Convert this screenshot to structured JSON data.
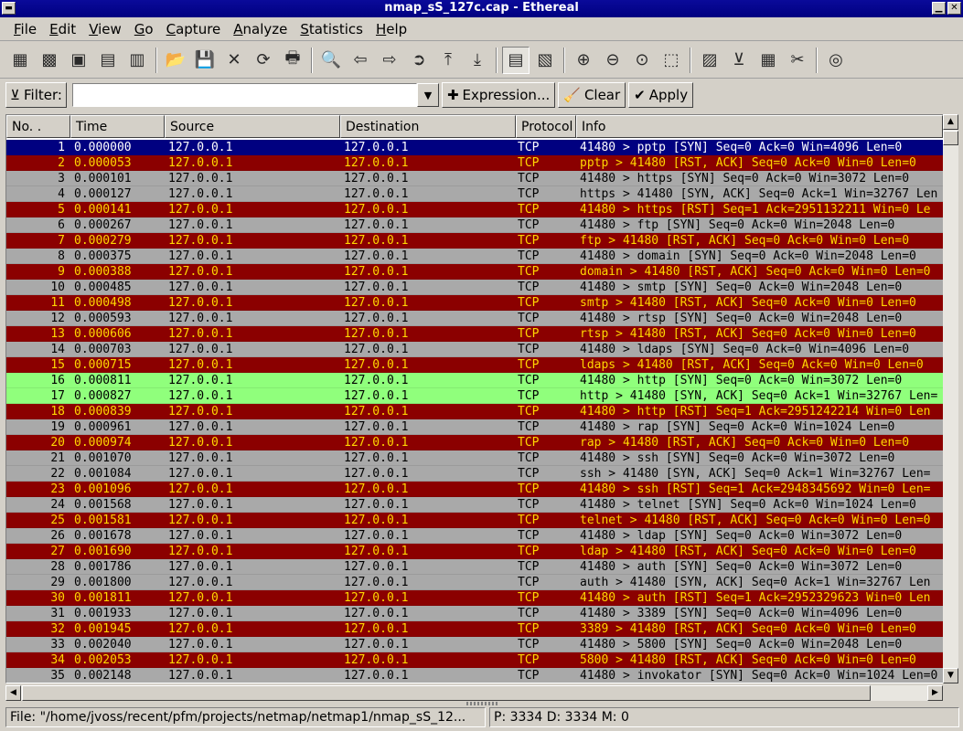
{
  "window": {
    "title": "nmap_sS_127c.cap - Ethereal"
  },
  "menu": [
    {
      "label": "File",
      "u": "F",
      "rest": "ile"
    },
    {
      "label": "Edit",
      "u": "E",
      "rest": "dit"
    },
    {
      "label": "View",
      "u": "V",
      "rest": "iew"
    },
    {
      "label": "Go",
      "u": "G",
      "rest": "o"
    },
    {
      "label": "Capture",
      "u": "C",
      "rest": "apture"
    },
    {
      "label": "Analyze",
      "u": "A",
      "rest": "nalyze"
    },
    {
      "label": "Statistics",
      "u": "S",
      "rest": "tatistics"
    },
    {
      "label": "Help",
      "u": "H",
      "rest": "elp"
    }
  ],
  "filter": {
    "label": "Filter:",
    "value": "",
    "expression_label": "Expression...",
    "clear_label": "Clear",
    "apply_label": "Apply"
  },
  "columns": [
    "No. .",
    "Time",
    "Source",
    "Destination",
    "Protocol",
    "Info"
  ],
  "colors": {
    "selected_bg": "#000080",
    "selected_fg": "#ffffff",
    "rst_bg": "#8b0000",
    "rst_fg": "#ffd700",
    "syn_bg": "#a9a9a9",
    "syn_fg": "#000000",
    "http_bg": "#90ff7c",
    "http_fg": "#000000"
  },
  "packets": [
    {
      "no": "1",
      "time": "0.000000",
      "src": "127.0.0.1",
      "dst": "127.0.0.1",
      "proto": "TCP",
      "info": "41480 > pptp [SYN] Seq=0 Ack=0 Win=4096 Len=0",
      "style": "selected"
    },
    {
      "no": "2",
      "time": "0.000053",
      "src": "127.0.0.1",
      "dst": "127.0.0.1",
      "proto": "TCP",
      "info": "pptp > 41480 [RST, ACK] Seq=0 Ack=0 Win=0 Len=0",
      "style": "rst"
    },
    {
      "no": "3",
      "time": "0.000101",
      "src": "127.0.0.1",
      "dst": "127.0.0.1",
      "proto": "TCP",
      "info": "41480 > https [SYN] Seq=0 Ack=0 Win=3072 Len=0",
      "style": "syn"
    },
    {
      "no": "4",
      "time": "0.000127",
      "src": "127.0.0.1",
      "dst": "127.0.0.1",
      "proto": "TCP",
      "info": "https > 41480 [SYN, ACK] Seq=0 Ack=1 Win=32767 Len",
      "style": "syn"
    },
    {
      "no": "5",
      "time": "0.000141",
      "src": "127.0.0.1",
      "dst": "127.0.0.1",
      "proto": "TCP",
      "info": "41480 > https [RST] Seq=1 Ack=2951132211 Win=0 Le",
      "style": "rst"
    },
    {
      "no": "6",
      "time": "0.000267",
      "src": "127.0.0.1",
      "dst": "127.0.0.1",
      "proto": "TCP",
      "info": "41480 > ftp [SYN] Seq=0 Ack=0 Win=2048 Len=0",
      "style": "syn"
    },
    {
      "no": "7",
      "time": "0.000279",
      "src": "127.0.0.1",
      "dst": "127.0.0.1",
      "proto": "TCP",
      "info": "ftp > 41480 [RST, ACK] Seq=0 Ack=0 Win=0 Len=0",
      "style": "rst"
    },
    {
      "no": "8",
      "time": "0.000375",
      "src": "127.0.0.1",
      "dst": "127.0.0.1",
      "proto": "TCP",
      "info": "41480 > domain [SYN] Seq=0 Ack=0 Win=2048 Len=0",
      "style": "syn"
    },
    {
      "no": "9",
      "time": "0.000388",
      "src": "127.0.0.1",
      "dst": "127.0.0.1",
      "proto": "TCP",
      "info": "domain > 41480 [RST, ACK] Seq=0 Ack=0 Win=0 Len=0",
      "style": "rst"
    },
    {
      "no": "10",
      "time": "0.000485",
      "src": "127.0.0.1",
      "dst": "127.0.0.1",
      "proto": "TCP",
      "info": "41480 > smtp [SYN] Seq=0 Ack=0 Win=2048 Len=0",
      "style": "syn"
    },
    {
      "no": "11",
      "time": "0.000498",
      "src": "127.0.0.1",
      "dst": "127.0.0.1",
      "proto": "TCP",
      "info": "smtp > 41480 [RST, ACK] Seq=0 Ack=0 Win=0 Len=0",
      "style": "rst"
    },
    {
      "no": "12",
      "time": "0.000593",
      "src": "127.0.0.1",
      "dst": "127.0.0.1",
      "proto": "TCP",
      "info": "41480 > rtsp [SYN] Seq=0 Ack=0 Win=2048 Len=0",
      "style": "syn"
    },
    {
      "no": "13",
      "time": "0.000606",
      "src": "127.0.0.1",
      "dst": "127.0.0.1",
      "proto": "TCP",
      "info": "rtsp > 41480 [RST, ACK] Seq=0 Ack=0 Win=0 Len=0",
      "style": "rst"
    },
    {
      "no": "14",
      "time": "0.000703",
      "src": "127.0.0.1",
      "dst": "127.0.0.1",
      "proto": "TCP",
      "info": "41480 > ldaps [SYN] Seq=0 Ack=0 Win=4096 Len=0",
      "style": "syn"
    },
    {
      "no": "15",
      "time": "0.000715",
      "src": "127.0.0.1",
      "dst": "127.0.0.1",
      "proto": "TCP",
      "info": "ldaps > 41480 [RST, ACK] Seq=0 Ack=0 Win=0 Len=0",
      "style": "rst"
    },
    {
      "no": "16",
      "time": "0.000811",
      "src": "127.0.0.1",
      "dst": "127.0.0.1",
      "proto": "TCP",
      "info": "41480 > http [SYN] Seq=0 Ack=0 Win=3072 Len=0",
      "style": "http"
    },
    {
      "no": "17",
      "time": "0.000827",
      "src": "127.0.0.1",
      "dst": "127.0.0.1",
      "proto": "TCP",
      "info": "http > 41480 [SYN, ACK] Seq=0 Ack=1 Win=32767 Len=",
      "style": "http"
    },
    {
      "no": "18",
      "time": "0.000839",
      "src": "127.0.0.1",
      "dst": "127.0.0.1",
      "proto": "TCP",
      "info": "41480 > http [RST] Seq=1 Ack=2951242214 Win=0 Len",
      "style": "rst"
    },
    {
      "no": "19",
      "time": "0.000961",
      "src": "127.0.0.1",
      "dst": "127.0.0.1",
      "proto": "TCP",
      "info": "41480 > rap [SYN] Seq=0 Ack=0 Win=1024 Len=0",
      "style": "syn"
    },
    {
      "no": "20",
      "time": "0.000974",
      "src": "127.0.0.1",
      "dst": "127.0.0.1",
      "proto": "TCP",
      "info": "rap > 41480 [RST, ACK] Seq=0 Ack=0 Win=0 Len=0",
      "style": "rst"
    },
    {
      "no": "21",
      "time": "0.001070",
      "src": "127.0.0.1",
      "dst": "127.0.0.1",
      "proto": "TCP",
      "info": "41480 > ssh [SYN] Seq=0 Ack=0 Win=3072 Len=0",
      "style": "syn"
    },
    {
      "no": "22",
      "time": "0.001084",
      "src": "127.0.0.1",
      "dst": "127.0.0.1",
      "proto": "TCP",
      "info": "ssh > 41480 [SYN, ACK] Seq=0 Ack=1 Win=32767 Len=",
      "style": "syn"
    },
    {
      "no": "23",
      "time": "0.001096",
      "src": "127.0.0.1",
      "dst": "127.0.0.1",
      "proto": "TCP",
      "info": "41480 > ssh [RST] Seq=1 Ack=2948345692 Win=0 Len=",
      "style": "rst"
    },
    {
      "no": "24",
      "time": "0.001568",
      "src": "127.0.0.1",
      "dst": "127.0.0.1",
      "proto": "TCP",
      "info": "41480 > telnet [SYN] Seq=0 Ack=0 Win=1024 Len=0",
      "style": "syn"
    },
    {
      "no": "25",
      "time": "0.001581",
      "src": "127.0.0.1",
      "dst": "127.0.0.1",
      "proto": "TCP",
      "info": "telnet > 41480 [RST, ACK] Seq=0 Ack=0 Win=0 Len=0",
      "style": "rst"
    },
    {
      "no": "26",
      "time": "0.001678",
      "src": "127.0.0.1",
      "dst": "127.0.0.1",
      "proto": "TCP",
      "info": "41480 > ldap [SYN] Seq=0 Ack=0 Win=3072 Len=0",
      "style": "syn"
    },
    {
      "no": "27",
      "time": "0.001690",
      "src": "127.0.0.1",
      "dst": "127.0.0.1",
      "proto": "TCP",
      "info": "ldap > 41480 [RST, ACK] Seq=0 Ack=0 Win=0 Len=0",
      "style": "rst"
    },
    {
      "no": "28",
      "time": "0.001786",
      "src": "127.0.0.1",
      "dst": "127.0.0.1",
      "proto": "TCP",
      "info": "41480 > auth [SYN] Seq=0 Ack=0 Win=3072 Len=0",
      "style": "syn"
    },
    {
      "no": "29",
      "time": "0.001800",
      "src": "127.0.0.1",
      "dst": "127.0.0.1",
      "proto": "TCP",
      "info": "auth > 41480 [SYN, ACK] Seq=0 Ack=1 Win=32767 Len",
      "style": "syn"
    },
    {
      "no": "30",
      "time": "0.001811",
      "src": "127.0.0.1",
      "dst": "127.0.0.1",
      "proto": "TCP",
      "info": "41480 > auth [RST] Seq=1 Ack=2952329623 Win=0 Len",
      "style": "rst"
    },
    {
      "no": "31",
      "time": "0.001933",
      "src": "127.0.0.1",
      "dst": "127.0.0.1",
      "proto": "TCP",
      "info": "41480 > 3389 [SYN] Seq=0 Ack=0 Win=4096 Len=0",
      "style": "syn"
    },
    {
      "no": "32",
      "time": "0.001945",
      "src": "127.0.0.1",
      "dst": "127.0.0.1",
      "proto": "TCP",
      "info": "3389 > 41480 [RST, ACK] Seq=0 Ack=0 Win=0 Len=0",
      "style": "rst"
    },
    {
      "no": "33",
      "time": "0.002040",
      "src": "127.0.0.1",
      "dst": "127.0.0.1",
      "proto": "TCP",
      "info": "41480 > 5800 [SYN] Seq=0 Ack=0 Win=2048 Len=0",
      "style": "syn"
    },
    {
      "no": "34",
      "time": "0.002053",
      "src": "127.0.0.1",
      "dst": "127.0.0.1",
      "proto": "TCP",
      "info": "5800 > 41480 [RST, ACK] Seq=0 Ack=0 Win=0 Len=0",
      "style": "rst"
    },
    {
      "no": "35",
      "time": "0.002148",
      "src": "127.0.0.1",
      "dst": "127.0.0.1",
      "proto": "TCP",
      "info": "41480 > invokator [SYN] Seq=0 Ack=0 Win=1024 Len=0",
      "style": "syn"
    }
  ],
  "status": {
    "file": "File: \"/home/jvoss/recent/pfm/projects/netmap/netmap1/nmap_sS_12...",
    "packets": "P: 3334 D: 3334 M: 0"
  },
  "icons": {
    "toolbar": [
      "interfaces-icon",
      "capture-options-icon",
      "capture-start-icon",
      "capture-stop-icon",
      "capture-restart-icon",
      "open-icon",
      "save-icon",
      "close-icon",
      "reload-icon",
      "print-icon",
      "find-icon",
      "back-icon",
      "forward-icon",
      "goto-icon",
      "first-icon",
      "last-icon",
      "colorize-icon",
      "autoscroll-icon",
      "zoom-in-icon",
      "zoom-out-icon",
      "zoom-normal-icon",
      "resize-columns-icon",
      "capture-filter-icon",
      "display-filter-icon",
      "coloring-rules-icon",
      "preferences-icon",
      "help-icon"
    ]
  }
}
